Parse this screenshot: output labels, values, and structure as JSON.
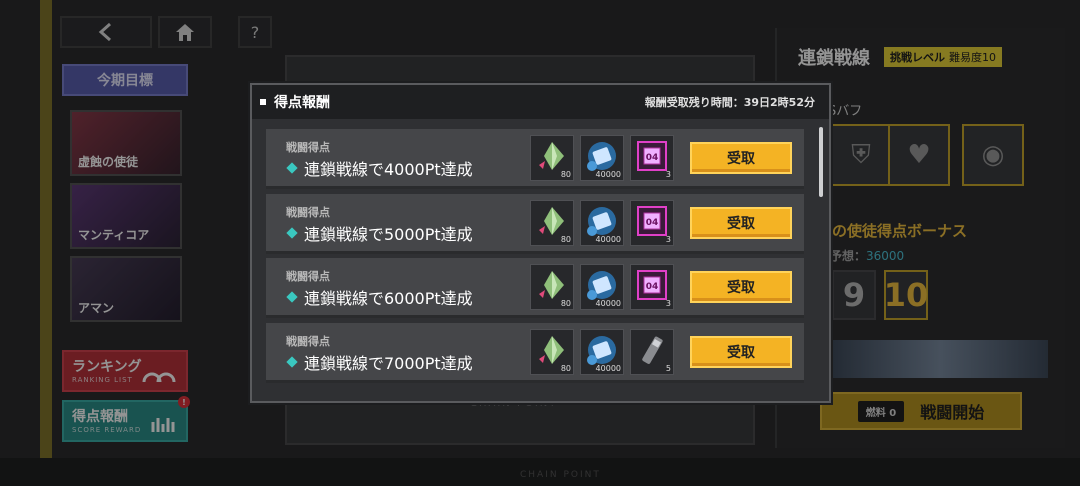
{
  "nav": {
    "back_icon": "chevron-left",
    "home_icon": "home",
    "help_label": "?"
  },
  "sidebar": {
    "goal_label": "今期目標",
    "bosses": [
      {
        "name": "虚蝕の使徒"
      },
      {
        "name": "マンティコア"
      },
      {
        "name": "アマン"
      }
    ],
    "ranking": {
      "label": "ランキング",
      "sub": "RANKING LIST"
    },
    "score_reward": {
      "label": "得点報酬",
      "sub": "SCORE REWARD",
      "badge": "!"
    }
  },
  "background": {
    "chain_text": "CHAIN POINT",
    "bottom_text": "CHAIN POINT"
  },
  "right_panel": {
    "title": "連鎖戦線",
    "level_label": "挑戦レベル",
    "level_value": "難易度10",
    "buff_label": "Sバフ",
    "bonus_label": "の使徒得点ボーナス",
    "pred_label": "予想：",
    "pred_value": "36000",
    "digits": [
      "9",
      "10"
    ],
    "fuel_label": "燃料 0",
    "start_label": "戦闘開始"
  },
  "modal": {
    "title": "得点報酬",
    "remaining": "報酬受取残り時間：39日2時52分",
    "rows": [
      {
        "category": "戦闘得点",
        "desc": "連鎖戦線で4000Pt達成",
        "items": [
          {
            "icon": "shard-icon",
            "count": "80"
          },
          {
            "icon": "credit-chip-icon",
            "count": "40000"
          },
          {
            "icon": "chip-04-icon",
            "count": "3"
          }
        ],
        "claim": "受取"
      },
      {
        "category": "戦闘得点",
        "desc": "連鎖戦線で5000Pt達成",
        "items": [
          {
            "icon": "shard-icon",
            "count": "80"
          },
          {
            "icon": "credit-chip-icon",
            "count": "40000"
          },
          {
            "icon": "chip-04-icon",
            "count": "3"
          }
        ],
        "claim": "受取"
      },
      {
        "category": "戦闘得点",
        "desc": "連鎖戦線で6000Pt達成",
        "items": [
          {
            "icon": "shard-icon",
            "count": "80"
          },
          {
            "icon": "credit-chip-icon",
            "count": "40000"
          },
          {
            "icon": "chip-04-icon",
            "count": "3"
          }
        ],
        "claim": "受取"
      },
      {
        "category": "戦闘得点",
        "desc": "連鎖戦線で7000Pt達成",
        "items": [
          {
            "icon": "shard-icon",
            "count": "80"
          },
          {
            "icon": "credit-chip-icon",
            "count": "40000"
          },
          {
            "icon": "module-stick-icon",
            "count": "5"
          }
        ],
        "claim": "受取"
      }
    ]
  },
  "colors": {
    "accent": "#f4b324",
    "teal": "#3ac8c0",
    "chip": "#e040c8"
  }
}
